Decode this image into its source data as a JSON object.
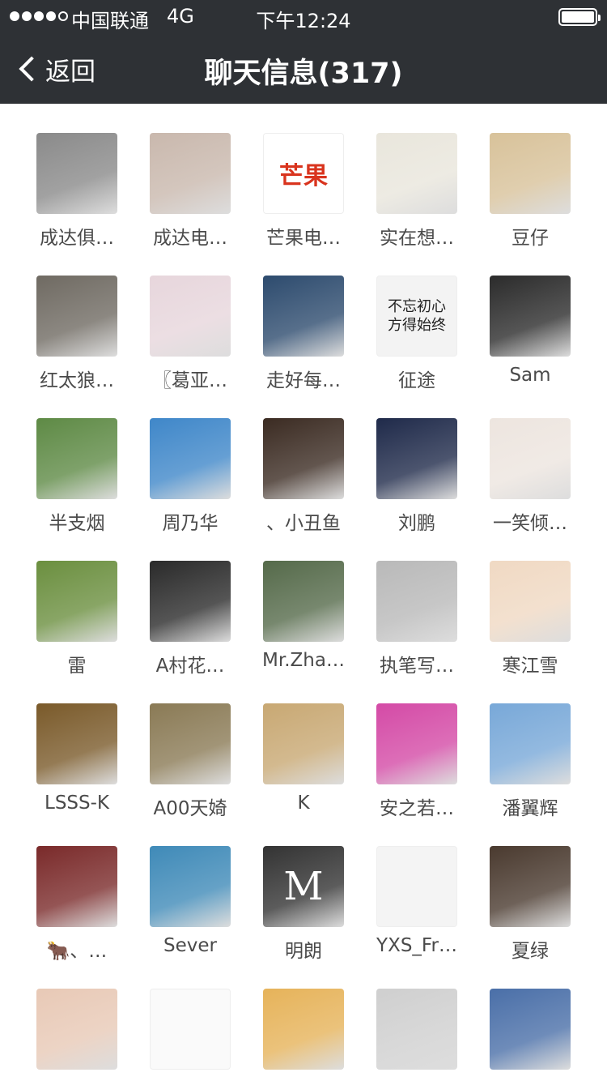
{
  "status_bar": {
    "carrier": "中国联通",
    "network": "4G",
    "time": "下午12:24"
  },
  "nav": {
    "back_label": "返回",
    "title": "聊天信息(317)"
  },
  "members": [
    {
      "name": "成达俱…"
    },
    {
      "name": "成达电…"
    },
    {
      "name": "芒果电…",
      "avatar_text": "芒果"
    },
    {
      "name": "实在想…"
    },
    {
      "name": "豆仔"
    },
    {
      "name": "红太狼…"
    },
    {
      "name": "〖葛亚…"
    },
    {
      "name": "走好每…"
    },
    {
      "name": "征途",
      "avatar_text": "不忘初心 方得始终"
    },
    {
      "name": "Sam"
    },
    {
      "name": "半支烟"
    },
    {
      "name": "周乃华"
    },
    {
      "name": "、小丑鱼"
    },
    {
      "name": "刘鹏"
    },
    {
      "name": "一笑倾…"
    },
    {
      "name": "雷"
    },
    {
      "name": "A村花…"
    },
    {
      "name": "Mr.Zha…"
    },
    {
      "name": "执笔写…"
    },
    {
      "name": "寒江雪"
    },
    {
      "name": "LSSS-K"
    },
    {
      "name": "A00天婍"
    },
    {
      "name": "K"
    },
    {
      "name": "安之若…"
    },
    {
      "name": "潘翼辉"
    },
    {
      "name": "🐂、…"
    },
    {
      "name": "Sever"
    },
    {
      "name": "明朗",
      "avatar_text": "M"
    },
    {
      "name": "YXS_Fr…"
    },
    {
      "name": "夏绿"
    },
    {
      "name": ""
    },
    {
      "name": ""
    },
    {
      "name": ""
    },
    {
      "name": ""
    },
    {
      "name": ""
    }
  ],
  "avatar_colors": [
    "#8a8a8a",
    "#c9b8ad",
    "#ffffff",
    "#e9e6dc",
    "#d8c29a",
    "#6f6a62",
    "#e7d6dc",
    "#2d4b6e",
    "#f3f3f3",
    "#2b2b2b",
    "#5e8a45",
    "#3f87c9",
    "#3b2b22",
    "#1f2a4a",
    "#ede5df",
    "#6b8f3f",
    "#2a2a2a",
    "#556a4a",
    "#b9b9b9",
    "#f0d9c3",
    "#7a5a2a",
    "#8a7a55",
    "#c8a873",
    "#d44aa6",
    "#78a8d8",
    "#7a2a2a",
    "#3f8ab8",
    "#333333",
    "#f4f4f4",
    "#4a3a2f",
    "#e8c9b6",
    "#fafafa",
    "#e6b35a",
    "#cfcfcf",
    "#4a6fa8"
  ]
}
